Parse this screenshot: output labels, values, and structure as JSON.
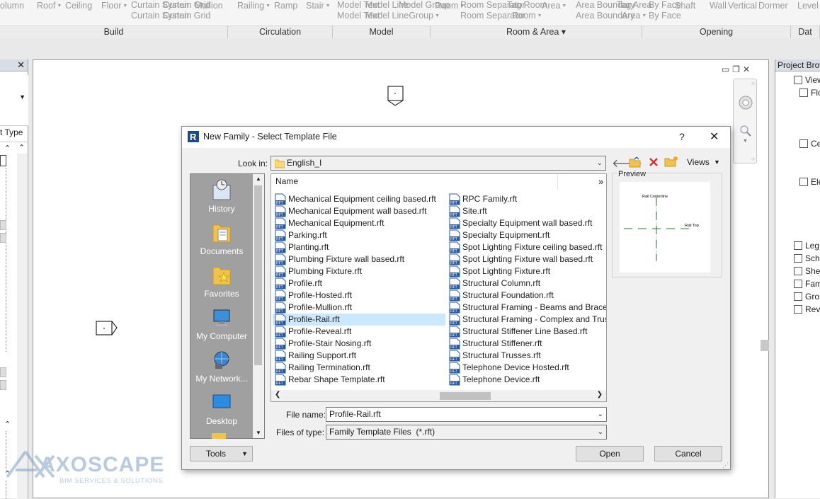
{
  "ribbon": {
    "buttons": [
      {
        "label": "olumn",
        "x": 0
      },
      {
        "label": "Roof",
        "dd": true
      },
      {
        "label": "Ceiling"
      },
      {
        "label": "Floor",
        "dd": true
      },
      {
        "label": "Curtain\nSystem"
      },
      {
        "label": "Curtain\nGrid"
      },
      {
        "label": "Mullion"
      },
      {
        "label": "Railing",
        "dd": true
      },
      {
        "label": "Ramp"
      },
      {
        "label": "Stair",
        "dd": true
      },
      {
        "label": "Model\nText"
      },
      {
        "label": "Model\nLine"
      },
      {
        "label": "Model\nGroup",
        "dd": true
      },
      {
        "label": "Room",
        "dd": true
      },
      {
        "label": "Room\nSeparator"
      },
      {
        "label": "Tag\nRoom",
        "dd": true
      },
      {
        "label": "Area",
        "dd": true
      },
      {
        "label": "Area\nBoundary"
      },
      {
        "label": "Tag\nArea",
        "dd": true
      },
      {
        "label": "By\nFace"
      },
      {
        "label": "Shaft"
      },
      {
        "label": "Wall"
      },
      {
        "label": "Vertical"
      },
      {
        "label": "Dormer"
      },
      {
        "label": "Level"
      }
    ],
    "panels": [
      "Build",
      "Circulation",
      "Model",
      "Room & Area ▾",
      "Opening",
      "Dat"
    ]
  },
  "left_panel": {
    "type_label": "t Type"
  },
  "project_browser": {
    "title": "Project Browser",
    "items": [
      "View",
      "Flo",
      "Cei",
      "Ele",
      "Leg",
      "Sch",
      "She",
      "Fam",
      "Gro",
      "Rev"
    ]
  },
  "dialog": {
    "title": "New Family - Select Template File",
    "help": "?",
    "close": "✕",
    "look_in_label": "Look in:",
    "look_in_value": "English_I",
    "views_label": "Views",
    "name_header": "Name",
    "more": "»",
    "preview_label": "Preview",
    "preview_texts": [
      "Rail Centerline",
      "Rail Top"
    ],
    "places": [
      "History",
      "Documents",
      "Favorites",
      "My Computer",
      "My Network...",
      "Desktop"
    ],
    "files_col1": [
      "Mechanical Equipment ceiling based.rft",
      "Mechanical Equipment wall based.rft",
      "Mechanical Equipment.rft",
      "Parking.rft",
      "Planting.rft",
      "Plumbing Fixture wall based.rft",
      "Plumbing Fixture.rft",
      "Profile.rft",
      "Profile-Hosted.rft",
      "Profile-Mullion.rft",
      "Profile-Rail.rft",
      "Profile-Reveal.rft",
      "Profile-Stair Nosing.rft",
      "Railing Support.rft",
      "Railing Termination.rft",
      "Rebar Shape Template.rft"
    ],
    "files_col2": [
      "RPC Family.rft",
      "Site.rft",
      "Specialty Equipment wall based.rft",
      "Specialty Equipment.rft",
      "Spot Lighting Fixture ceiling based.rft",
      "Spot Lighting Fixture wall based.rft",
      "Spot Lighting Fixture.rft",
      "Structural Column.rft",
      "Structural Foundation.rft",
      "Structural Framing - Beams and Braces.",
      "Structural Framing - Complex and Truss",
      "Structural Stiffener Line Based.rft",
      "Structural Stiffener.rft",
      "Structural Trusses.rft",
      "Telephone Device Hosted.rft",
      "Telephone Device.rft"
    ],
    "selected_file": "Profile-Rail.rft",
    "file_name_label": "File name:",
    "file_name_value": "Profile-Rail.rft",
    "files_of_type_label": "Files of type:",
    "files_of_type_value": "Family Template Files  (*.rft)",
    "tools_label": "Tools",
    "open_label": "Open",
    "cancel_label": "Cancel"
  },
  "watermark": {
    "brand": "AXOSCAPE",
    "tagline": "BIM SERVICES & SOLUTIONS"
  },
  "colors": {
    "selection": "#cce8ff",
    "places_bg": "#a0a0a0",
    "ribbon_text": "#9a9a9a",
    "watermark": "#7fa2c4"
  }
}
